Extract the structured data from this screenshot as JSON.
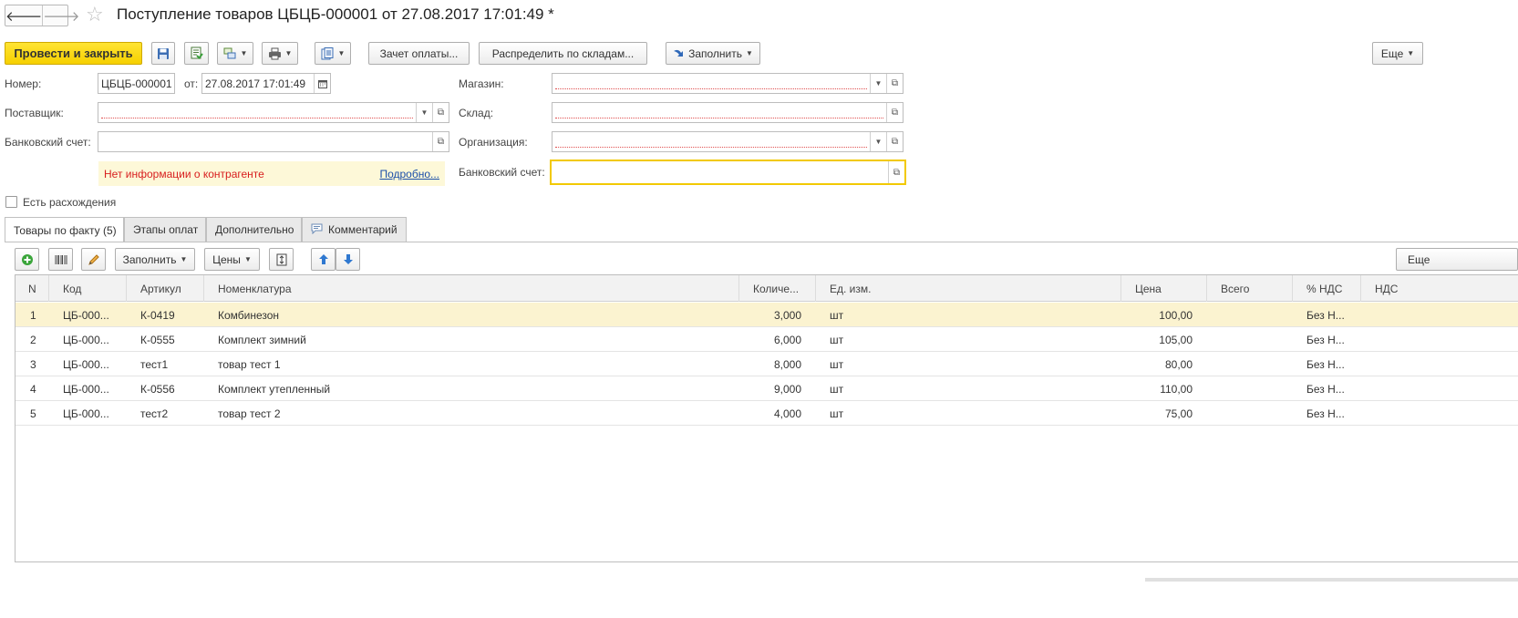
{
  "window": {
    "title": "Поступление товаров ЦБЦБ-000001 от 27.08.2017 17:01:49 *",
    "back_icon": "arrow-left",
    "forward_icon": "arrow-right",
    "favorite_icon": "star"
  },
  "toolbar": {
    "post_close_label": "Провести и закрыть",
    "payment_offset_label": "Зачет оплаты...",
    "distribute_label": "Распределить по складам...",
    "fill_label": "Заполнить",
    "more_label": "Еще"
  },
  "form": {
    "number_label": "Номер:",
    "number_value": "ЦБЦБ-000001",
    "date_from_label": "от:",
    "date_value": "27.08.2017 17:01:49",
    "supplier_label": "Поставщик:",
    "supplier_value": "",
    "bank_account_left_label": "Банковский счет:",
    "bank_account_left_value": "",
    "store_label": "Магазин:",
    "store_value": "",
    "warehouse_label": "Склад:",
    "warehouse_value": "",
    "organization_label": "Организация:",
    "organization_value": "",
    "bank_account_right_label": "Банковский счет:",
    "bank_account_right_value": "",
    "warning_text": "Нет информации о контрагенте",
    "details_link": "Подробно...",
    "discrepancy_label": "Есть расхождения",
    "discrepancy_checked": false
  },
  "tabs": [
    {
      "label": "Товары по факту (5)",
      "active": true
    },
    {
      "label": "Этапы оплат",
      "active": false
    },
    {
      "label": "Дополнительно",
      "active": false
    },
    {
      "label": "Комментарий",
      "active": false
    }
  ],
  "grid_toolbar": {
    "fill_label": "Заполнить",
    "prices_label": "Цены",
    "more_label": "Еще"
  },
  "table": {
    "columns": [
      "N",
      "Код",
      "Артикул",
      "Номенклатура",
      "Количе...",
      "Ед. изм.",
      "Цена",
      "Всего",
      "% НДС",
      "НДС"
    ],
    "rows": [
      {
        "n": "1",
        "code": "ЦБ-000...",
        "article": "К-0419",
        "name": "Комбинезон",
        "qty": "3,000",
        "unit": "шт",
        "price": "100,00",
        "total": "",
        "vat_rate": "Без Н...",
        "vat": ""
      },
      {
        "n": "2",
        "code": "ЦБ-000...",
        "article": "К-0555",
        "name": "Комплект зимний",
        "qty": "6,000",
        "unit": "шт",
        "price": "105,00",
        "total": "",
        "vat_rate": "Без Н...",
        "vat": ""
      },
      {
        "n": "3",
        "code": "ЦБ-000...",
        "article": "тест1",
        "name": "товар тест 1",
        "qty": "8,000",
        "unit": "шт",
        "price": "80,00",
        "total": "",
        "vat_rate": "Без Н...",
        "vat": ""
      },
      {
        "n": "4",
        "code": "ЦБ-000...",
        "article": "К-0556",
        "name": "Комплект утепленный",
        "qty": "9,000",
        "unit": "шт",
        "price": "110,00",
        "total": "",
        "vat_rate": "Без Н...",
        "vat": ""
      },
      {
        "n": "5",
        "code": "ЦБ-000...",
        "article": "тест2",
        "name": "товар тест 2",
        "qty": "4,000",
        "unit": "шт",
        "price": "75,00",
        "total": "",
        "vat_rate": "Без Н...",
        "vat": ""
      }
    ],
    "selected_row": 1
  },
  "colors": {
    "primary_button": "#f6d000",
    "selected_row": "#fbf3d0",
    "warning_bg": "#fdf8d8",
    "warning_text": "#d81e1e",
    "link": "#1a4ea8",
    "focus_border": "#f2c900"
  }
}
